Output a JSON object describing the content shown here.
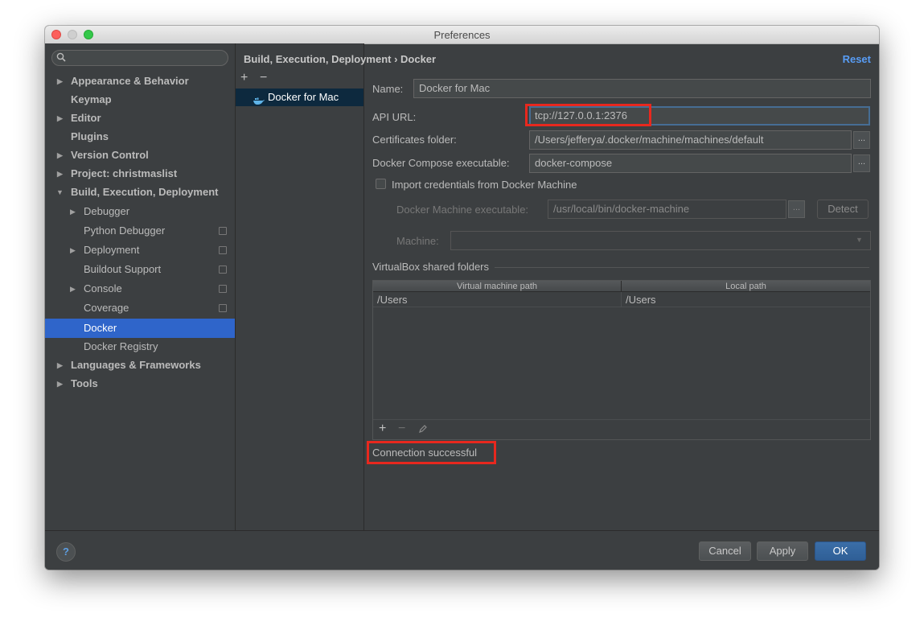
{
  "window": {
    "title": "Preferences"
  },
  "search": {
    "placeholder": ""
  },
  "sidebar": {
    "items": [
      {
        "label": "Appearance & Behavior"
      },
      {
        "label": "Keymap"
      },
      {
        "label": "Editor"
      },
      {
        "label": "Plugins"
      },
      {
        "label": "Version Control"
      },
      {
        "label": "Project: christmaslist"
      },
      {
        "label": "Build, Execution, Deployment"
      },
      {
        "label": "Debugger"
      },
      {
        "label": "Python Debugger"
      },
      {
        "label": "Deployment"
      },
      {
        "label": "Buildout Support"
      },
      {
        "label": "Console"
      },
      {
        "label": "Coverage"
      },
      {
        "label": "Docker"
      },
      {
        "label": "Docker Registry"
      },
      {
        "label": "Languages & Frameworks"
      },
      {
        "label": "Tools"
      }
    ]
  },
  "config_list": {
    "add": "+",
    "remove": "−",
    "items": [
      {
        "label": "Docker for Mac"
      }
    ]
  },
  "header": {
    "breadcrumb": "Build, Execution, Deployment › Docker",
    "reset": "Reset"
  },
  "form": {
    "name_label": "Name:",
    "name_value": "Docker for Mac",
    "api_url_label": "API URL:",
    "api_url_value": "tcp://127.0.0.1:2376",
    "certs_label": "Certificates folder:",
    "certs_value": "/Users/jefferya/.docker/machine/machines/default",
    "compose_label": "Docker Compose executable:",
    "compose_value": "docker-compose",
    "browse": "...",
    "import_label": "Import credentials from Docker Machine",
    "machine_exec_label": "Docker Machine executable:",
    "machine_exec_value": "/usr/local/bin/docker-machine",
    "detect": "Detect",
    "machine_label": "Machine:",
    "machine_value": "",
    "dropdown_arrow": "▼"
  },
  "shared_folders": {
    "title": "VirtualBox shared folders",
    "columns": [
      "Virtual machine path",
      "Local path"
    ],
    "rows": [
      [
        "/Users",
        "/Users"
      ]
    ],
    "add": "+",
    "remove": "−"
  },
  "status": {
    "text": "Connection successful"
  },
  "footer": {
    "help": "?",
    "cancel": "Cancel",
    "apply": "Apply",
    "ok": "OK"
  }
}
